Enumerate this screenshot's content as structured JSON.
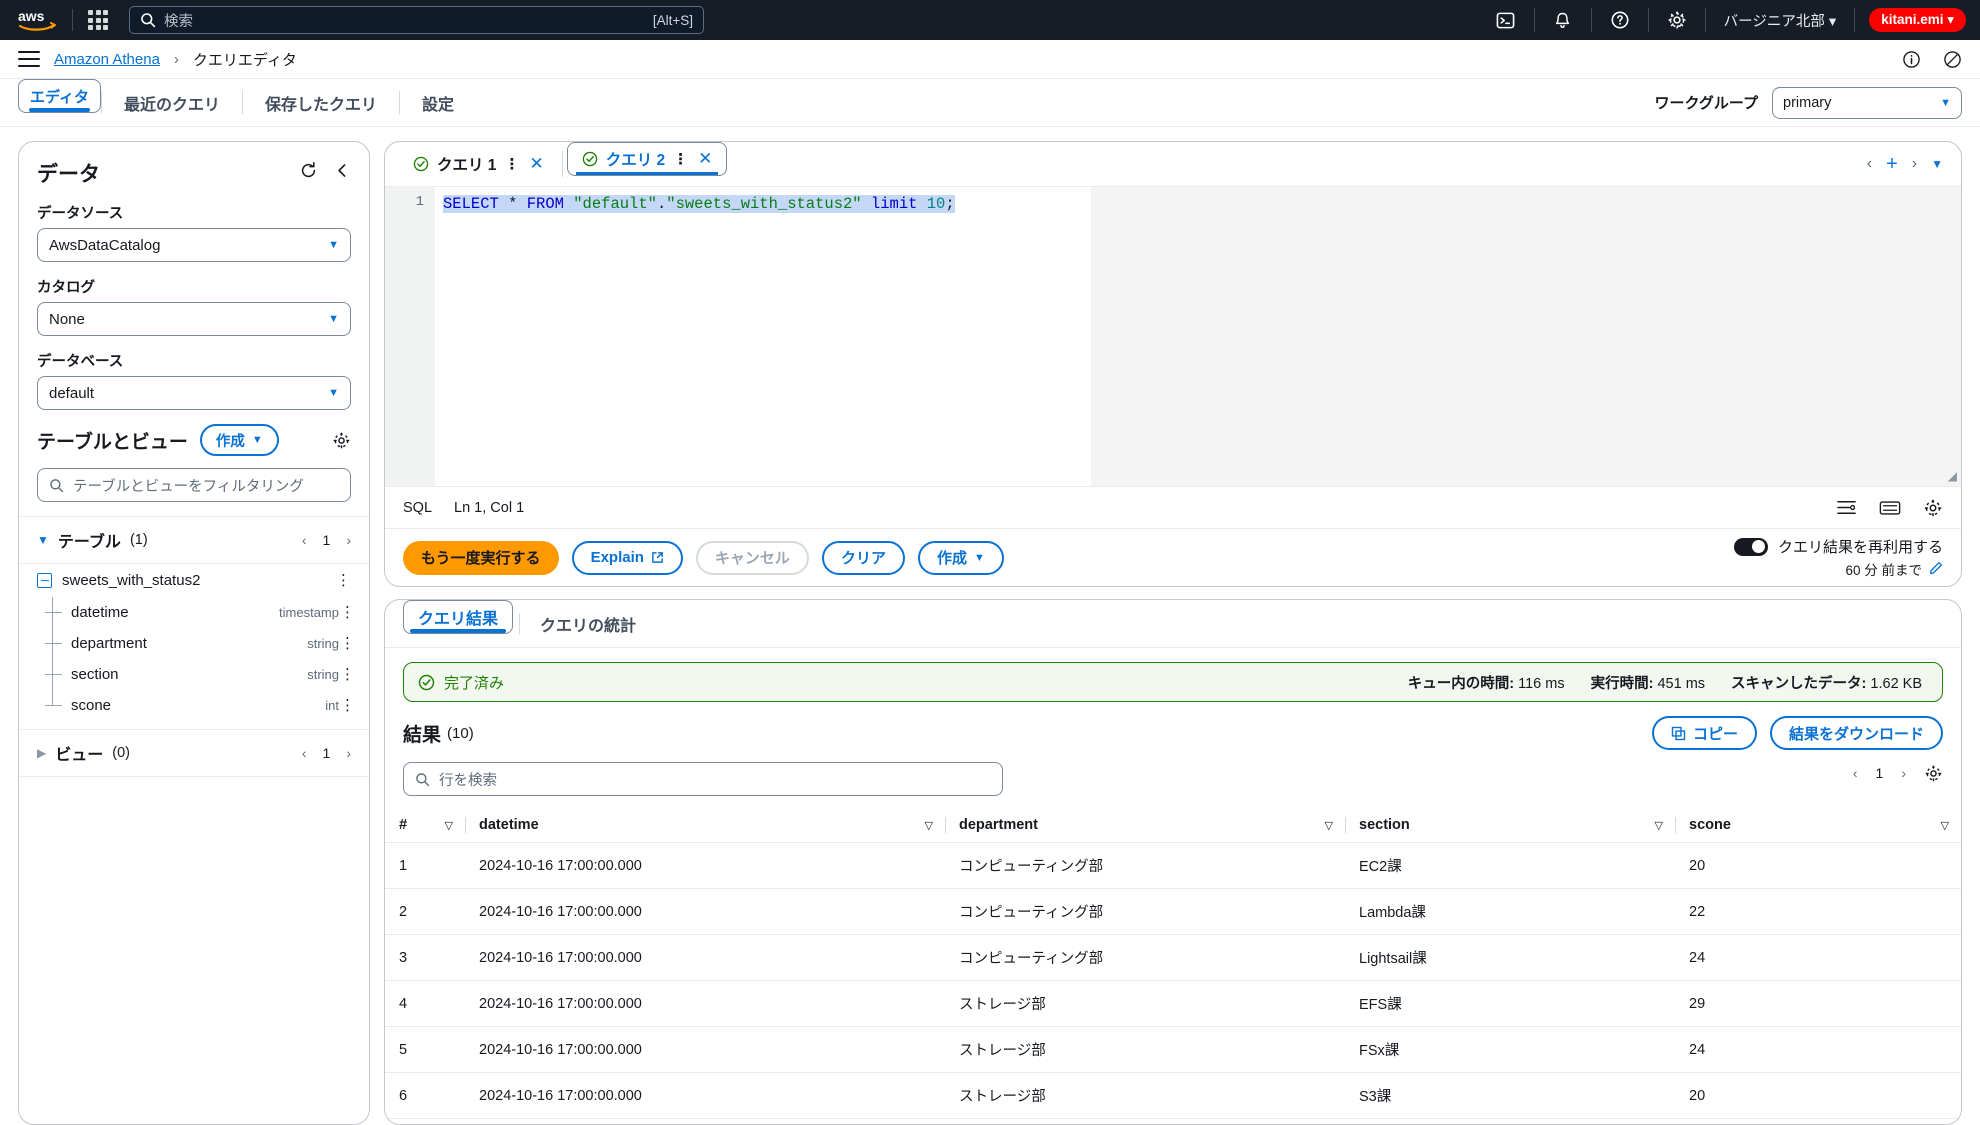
{
  "topbar": {
    "logo_alt": "aws",
    "search_placeholder": "検索",
    "search_shortcut": "[Alt+S]",
    "region": "バージニア北部",
    "user": "kitani.emi",
    "icons": [
      "apps-grid-icon",
      "cloudshell-icon",
      "bell-icon",
      "help-icon",
      "settings-icon"
    ]
  },
  "breadcrumb": {
    "service": "Amazon Athena",
    "separator": "›",
    "current": "クエリエディタ"
  },
  "page_tabs": {
    "items": [
      {
        "label": "エディタ",
        "selected": true
      },
      {
        "label": "最近のクエリ",
        "selected": false
      },
      {
        "label": "保存したクエリ",
        "selected": false
      },
      {
        "label": "設定",
        "selected": false
      }
    ],
    "workgroup_label": "ワークグループ",
    "workgroup_value": "primary"
  },
  "data_panel": {
    "title": "データ",
    "datasource_label": "データソース",
    "datasource_value": "AwsDataCatalog",
    "catalog_label": "カタログ",
    "catalog_value": "None",
    "database_label": "データベース",
    "database_value": "default",
    "tables_views_title": "テーブルとビュー",
    "create_button": "作成",
    "filter_placeholder": "テーブルとビューをフィルタリング",
    "tables_group": {
      "label": "テーブル",
      "count": "(1)",
      "page": "1"
    },
    "views_group": {
      "label": "ビュー",
      "count": "(0)",
      "page": "1"
    },
    "table_name": "sweets_with_status2",
    "columns": [
      {
        "name": "datetime",
        "type": "timestamp"
      },
      {
        "name": "department",
        "type": "string"
      },
      {
        "name": "section",
        "type": "string"
      },
      {
        "name": "scone",
        "type": "int"
      }
    ]
  },
  "editor": {
    "tabs": [
      {
        "label": "クエリ 1",
        "selected": false
      },
      {
        "label": "クエリ 2",
        "selected": true
      }
    ],
    "line_number": "1",
    "sql_parts": {
      "select": "SELECT ",
      "star": "* ",
      "from": "FROM ",
      "db": "\"default\"",
      "dot": ".",
      "table": "\"sweets_with_status2\"",
      "limit": " limit ",
      "num": "10",
      "semi": ";"
    },
    "sql_full": "SELECT * FROM \"default\".\"sweets_with_status2\" limit 10;",
    "status_language": "SQL",
    "status_position": "Ln 1, Col 1",
    "buttons": {
      "run": "もう一度実行する",
      "explain": "Explain",
      "cancel": "キャンセル",
      "clear": "クリア",
      "create": "作成"
    },
    "reuse_toggle_label": "クエリ結果を再利用する",
    "reuse_note": "60 分 前まで"
  },
  "results": {
    "tabs": [
      {
        "label": "クエリ結果",
        "selected": true
      },
      {
        "label": "クエリの統計",
        "selected": false
      }
    ],
    "status": "完了済み",
    "metrics": [
      {
        "label": "キュー内の時間:",
        "value": "116 ms"
      },
      {
        "label": "実行時間:",
        "value": "451 ms"
      },
      {
        "label": "スキャンしたデータ:",
        "value": "1.62 KB"
      }
    ],
    "title": "結果",
    "count": "(10)",
    "copy_button": "コピー",
    "download_button": "結果をダウンロード",
    "search_placeholder": "行を検索",
    "page": "1",
    "columns": [
      "#",
      "datetime",
      "department",
      "section",
      "scone"
    ],
    "rows": [
      {
        "num": "1",
        "datetime": "2024-10-16 17:00:00.000",
        "department": "コンピューティング部",
        "section": "EC2課",
        "scone": "20"
      },
      {
        "num": "2",
        "datetime": "2024-10-16 17:00:00.000",
        "department": "コンピューティング部",
        "section": "Lambda課",
        "scone": "22"
      },
      {
        "num": "3",
        "datetime": "2024-10-16 17:00:00.000",
        "department": "コンピューティング部",
        "section": "Lightsail課",
        "scone": "24"
      },
      {
        "num": "4",
        "datetime": "2024-10-16 17:00:00.000",
        "department": "ストレージ部",
        "section": "EFS課",
        "scone": "29"
      },
      {
        "num": "5",
        "datetime": "2024-10-16 17:00:00.000",
        "department": "ストレージ部",
        "section": "FSx課",
        "scone": "24"
      },
      {
        "num": "6",
        "datetime": "2024-10-16 17:00:00.000",
        "department": "ストレージ部",
        "section": "S3課",
        "scone": "20"
      }
    ]
  },
  "colors": {
    "aws_dark": "#161d26",
    "link_blue": "#0972d3",
    "orange": "#ff9900",
    "success_green": "#1d8102",
    "user_red": "#ff0000"
  }
}
